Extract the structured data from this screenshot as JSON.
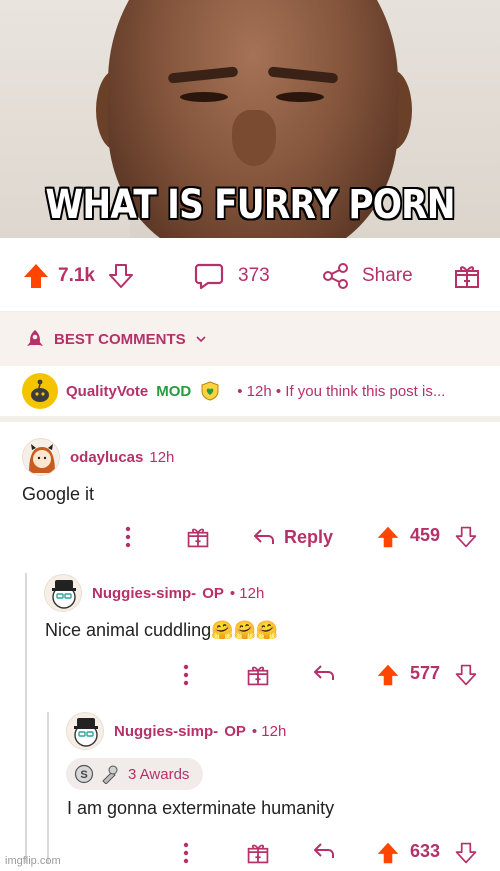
{
  "hero": {
    "caption": "WHAT IS FURRY PORN"
  },
  "actions": {
    "upvotes": "7.1k",
    "comments": "373",
    "share_label": "Share"
  },
  "sort": {
    "label": "BEST COMMENTS"
  },
  "mod_comment": {
    "user": "QualityVote",
    "badge": "MOD",
    "meta": "• 12h • If you think this post is..."
  },
  "comments": [
    {
      "user": "odaylucas",
      "time": "12h",
      "body": "Google it",
      "reply_label": "Reply",
      "score": "459"
    },
    {
      "user": "Nuggies-simp-",
      "op": "OP",
      "time": "• 12h",
      "body": "Nice animal cuddling🤗🤗🤗",
      "score": "577"
    },
    {
      "user": "Nuggies-simp-",
      "op": "OP",
      "time": "• 12h",
      "awards": "3 Awards",
      "body": "I am gonna exterminate humanity",
      "score": "633"
    }
  ],
  "watermark": "imgflip.com",
  "colors": {
    "accent": "#b5316a",
    "upvote": "#ff4500",
    "mod": "#2a9a3c"
  },
  "icons": [
    "upvote-icon",
    "downvote-icon",
    "comment-icon",
    "share-icon",
    "gift-icon",
    "rocket-icon",
    "chevron-down-icon",
    "more-icon",
    "reply-icon"
  ]
}
